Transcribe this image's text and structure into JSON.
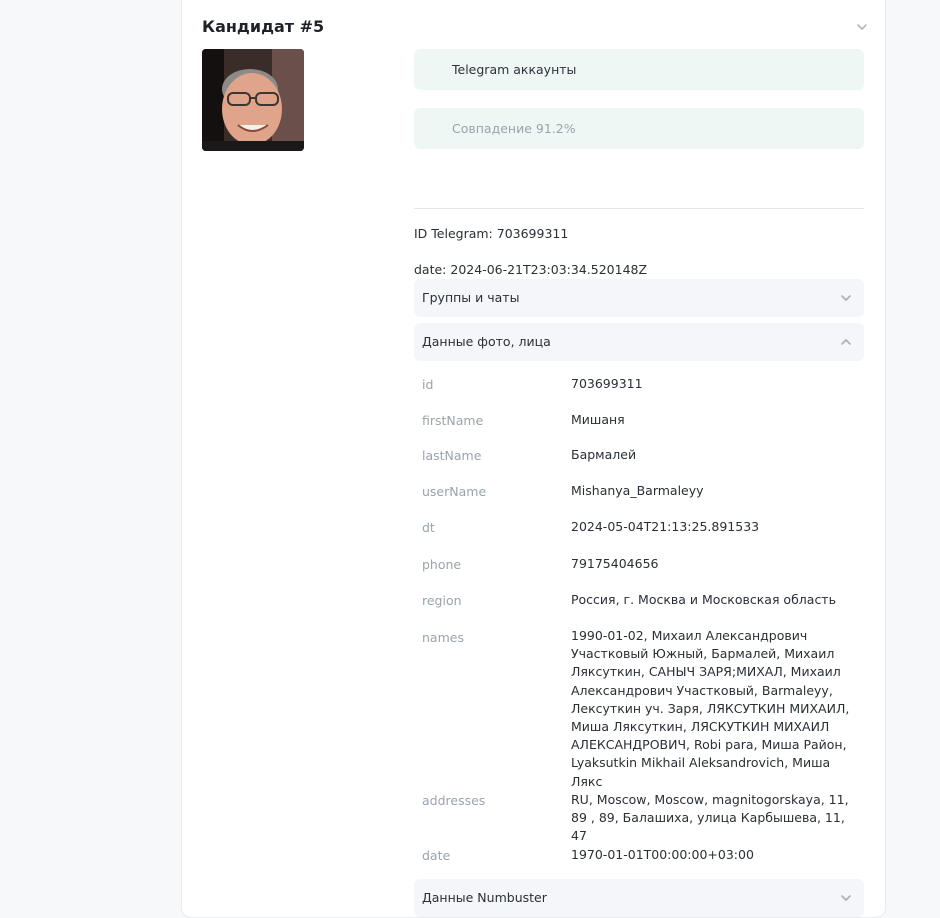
{
  "candidate": {
    "title": "Кандидат #5",
    "telegram_accounts_label": "Telegram аккаунты",
    "match_label": "Совпадение 91.2%",
    "telegram_id_line": "ID Telegram: 703699311",
    "date_line": "date: 2024-06-21T23:03:34.520148Z"
  },
  "sections": {
    "groups_label": "Группы и чаты",
    "face_data_label": "Данные фото, лица",
    "numbuster_label": "Данные Numbuster"
  },
  "details": [
    {
      "key": "id",
      "value": "703699311"
    },
    {
      "key": "firstName",
      "value": "Мишаня"
    },
    {
      "key": "lastName",
      "value": "Бармалей"
    },
    {
      "key": "userName",
      "value": "Mishanya_Barmaleyy"
    },
    {
      "key": "dt",
      "value": "2024-05-04T21:13:25.891533"
    },
    {
      "key": "phone",
      "value": "79175404656"
    },
    {
      "key": "region",
      "value": "Россия, г. Москва и Московская область"
    },
    {
      "key": "names",
      "value": "1990-01-02, Михаил Александрович Участковый Южный, Бармалей, Михаил Ляксуткин, САНЫЧ ЗАРЯ;МИХАЛ, Михаил Александрович Участковый, Barmaleyy, Лексуткин уч. Заря, ЛЯКСУТКИН МИХАИЛ, Миша Ляксуткин, ЛЯСКУТКИН МИХАИЛ АЛЕКСАНДРОВИЧ, Robi para, Миша Район, Lyaksutkin Mikhail Aleksandrovich, Миша Лякс"
    },
    {
      "key": "addresses",
      "value": "RU, Moscow, Moscow, magnitogorskaya, 11, 89 , 89, Балашиха, улица Карбышева, 11, 47"
    },
    {
      "key": "date",
      "value": "1970-01-01T00:00:00+03:00"
    }
  ],
  "icons": {
    "card_toggle": "chevron-down-icon",
    "groups_toggle": "chevron-down-icon",
    "face_toggle": "chevron-up-icon",
    "numbuster_toggle": "chevron-down-icon"
  },
  "colors": {
    "accent_pill": "#eef7f3",
    "section_bg": "#f4f6fa",
    "muted_text": "#9aa3ad"
  }
}
